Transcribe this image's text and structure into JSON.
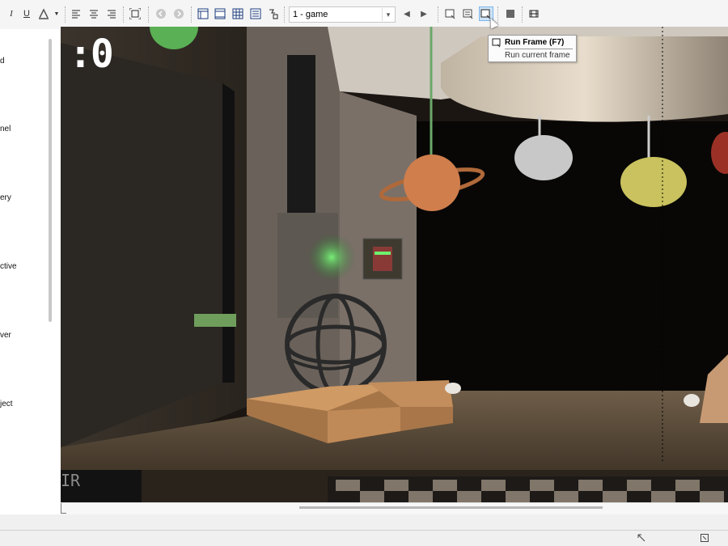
{
  "toolbar": {
    "italic": "I",
    "underline": "U",
    "frame_selector": "1 - game",
    "combo_arrow": "▾",
    "prev": "◀",
    "next": "▶"
  },
  "tooltip": {
    "title": "Run Frame (F7)",
    "description": "Run current frame"
  },
  "left_panel": {
    "items": [
      "d",
      "nel",
      "ery",
      "ctive",
      "ver",
      "ject"
    ]
  },
  "game": {
    "score": ":0",
    "corner_text": "IR"
  },
  "colors": {
    "accent": "#7eb4ea",
    "toolbar_bg": "#f5f5f5",
    "viewport_bg": "#1a1410"
  }
}
